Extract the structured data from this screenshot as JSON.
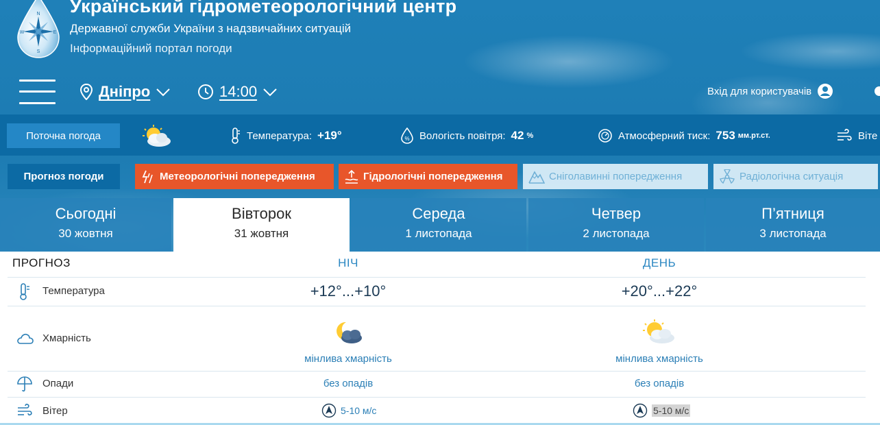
{
  "header": {
    "title": "Український гідрометеорологічний центр",
    "subtitle": "Державної служби України з надзвичайних ситуацій",
    "portal": "Інформаційний портал погоди",
    "compass_letters": {
      "n": "N",
      "s": "S",
      "w": "W",
      "e": "E"
    }
  },
  "nav": {
    "city": "Дніпро",
    "time": "14:00",
    "login": "Вхід для користувачів"
  },
  "current": {
    "button": "Поточна погода",
    "temperature_label": "Температура:",
    "temperature_value": "+19°",
    "humidity_label": "Вологість повітря:",
    "humidity_value": "42",
    "humidity_unit": "%",
    "pressure_label": "Атмосферний тиск:",
    "pressure_value": "753",
    "pressure_unit": "мм.рт.ст.",
    "wind_label_partial": "Віте"
  },
  "warnings": {
    "forecast_button": "Прогноз погоди",
    "meteo": "Метеорологічні попередження",
    "hydro": "Гідрологічні попередження",
    "avalanche": "Сніголавинні попередження",
    "radiation": "Радіологічна ситуація"
  },
  "days": [
    {
      "name": "Сьогодні",
      "date": "30 жовтня"
    },
    {
      "name": "Вівторок",
      "date": "31 жовтня"
    },
    {
      "name": "Середа",
      "date": "1 листопада"
    },
    {
      "name": "Четвер",
      "date": "2 листопада"
    },
    {
      "name": "П’ятниця",
      "date": "3 листопада"
    }
  ],
  "forecast": {
    "heading": "ПРОГНОЗ",
    "night": "НІЧ",
    "day": "ДЕНЬ",
    "rows": {
      "temperature": "Температура",
      "cloudiness": "Хмарність",
      "precipitation": "Опади",
      "wind": "Вітер"
    },
    "night_values": {
      "temperature": "+12°...+10°",
      "cloudiness": "мінлива хмарність",
      "precipitation": "без опадів",
      "wind": "5-10 м/с"
    },
    "day_values": {
      "temperature": "+20°...+22°",
      "cloudiness": "мінлива хмарність",
      "precipitation": "без опадів",
      "wind": "5-10 м/с"
    }
  },
  "colors": {
    "sky": "#1f80b8",
    "bar": "#0c6aa4",
    "accent_orange": "#e8562a",
    "link_blue": "#2b87c2"
  }
}
